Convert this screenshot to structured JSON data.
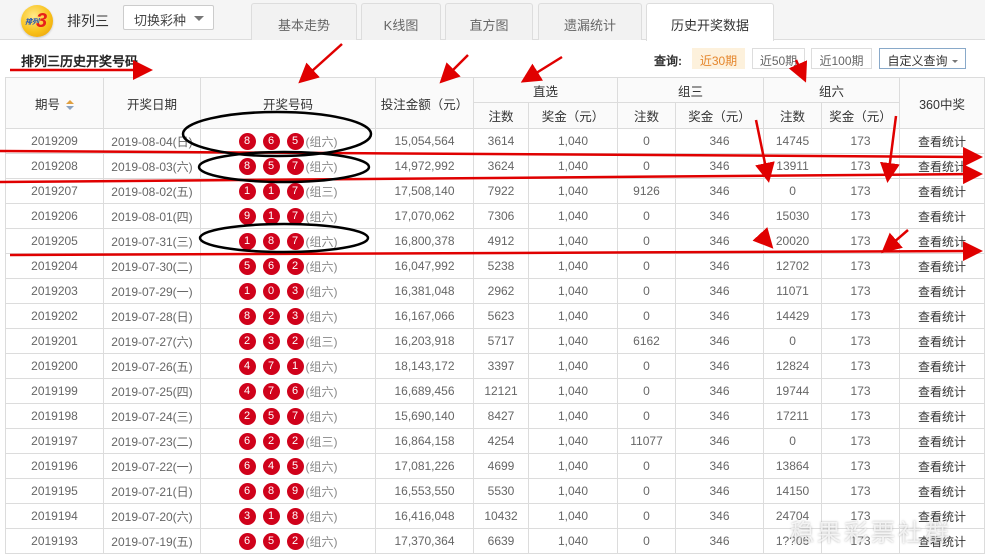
{
  "header": {
    "logo_text": "排列",
    "logo_num": "3",
    "lottery_name": "排列三",
    "switch_label": "切换彩种",
    "tabs": [
      {
        "label": "基本走势",
        "active": false
      },
      {
        "label": "K线图",
        "active": false
      },
      {
        "label": "直方图",
        "active": false
      },
      {
        "label": "遗漏统计",
        "active": false
      },
      {
        "label": "历史开奖数据",
        "active": true
      }
    ]
  },
  "subbar": {
    "title": "排列三历史开奖号码",
    "query_label": "查询:",
    "query_buttons": [
      {
        "label": "近30期",
        "active": true
      },
      {
        "label": "近50期",
        "active": false
      },
      {
        "label": "近100期",
        "active": false
      }
    ],
    "custom_query_label": "自定义查询"
  },
  "table": {
    "headers": {
      "issue": "期号",
      "date": "开奖日期",
      "numbers": "开奖号码",
      "bet_amount": "投注金额（元）",
      "direct": "直选",
      "group3": "组三",
      "group6": "组六",
      "count": "注数",
      "prize": "奖金（元）",
      "prize360": "360中奖"
    },
    "action_label": "查看统计",
    "rows": [
      {
        "issue": "2019209",
        "date": "2019-08-04(日)",
        "balls": [
          "8",
          "6",
          "5"
        ],
        "type": "(组六)",
        "amount": "15,054,564",
        "d_count": "3614",
        "d_prize": "1,040",
        "g3_count": "0",
        "g3_prize": "346",
        "g6_count": "14745",
        "g6_prize": "173"
      },
      {
        "issue": "2019208",
        "date": "2019-08-03(六)",
        "balls": [
          "8",
          "5",
          "7"
        ],
        "type": "(组六)",
        "amount": "14,972,992",
        "d_count": "3624",
        "d_prize": "1,040",
        "g3_count": "0",
        "g3_prize": "346",
        "g6_count": "13911",
        "g6_prize": "173"
      },
      {
        "issue": "2019207",
        "date": "2019-08-02(五)",
        "balls": [
          "1",
          "1",
          "7"
        ],
        "type": "(组三)",
        "amount": "17,508,140",
        "d_count": "7922",
        "d_prize": "1,040",
        "g3_count": "9126",
        "g3_prize": "346",
        "g6_count": "0",
        "g6_prize": "173"
      },
      {
        "issue": "2019206",
        "date": "2019-08-01(四)",
        "balls": [
          "9",
          "1",
          "7"
        ],
        "type": "(组六)",
        "amount": "17,070,062",
        "d_count": "7306",
        "d_prize": "1,040",
        "g3_count": "0",
        "g3_prize": "346",
        "g6_count": "15030",
        "g6_prize": "173"
      },
      {
        "issue": "2019205",
        "date": "2019-07-31(三)",
        "balls": [
          "1",
          "8",
          "7"
        ],
        "type": "(组六)",
        "amount": "16,800,378",
        "d_count": "4912",
        "d_prize": "1,040",
        "g3_count": "0",
        "g3_prize": "346",
        "g6_count": "20020",
        "g6_prize": "173"
      },
      {
        "issue": "2019204",
        "date": "2019-07-30(二)",
        "balls": [
          "5",
          "6",
          "2"
        ],
        "type": "(组六)",
        "amount": "16,047,992",
        "d_count": "5238",
        "d_prize": "1,040",
        "g3_count": "0",
        "g3_prize": "346",
        "g6_count": "12702",
        "g6_prize": "173"
      },
      {
        "issue": "2019203",
        "date": "2019-07-29(一)",
        "balls": [
          "1",
          "0",
          "3"
        ],
        "type": "(组六)",
        "amount": "16,381,048",
        "d_count": "2962",
        "d_prize": "1,040",
        "g3_count": "0",
        "g3_prize": "346",
        "g6_count": "11071",
        "g6_prize": "173"
      },
      {
        "issue": "2019202",
        "date": "2019-07-28(日)",
        "balls": [
          "8",
          "2",
          "3"
        ],
        "type": "(组六)",
        "amount": "16,167,066",
        "d_count": "5623",
        "d_prize": "1,040",
        "g3_count": "0",
        "g3_prize": "346",
        "g6_count": "14429",
        "g6_prize": "173"
      },
      {
        "issue": "2019201",
        "date": "2019-07-27(六)",
        "balls": [
          "2",
          "3",
          "2"
        ],
        "type": "(组三)",
        "amount": "16,203,918",
        "d_count": "5717",
        "d_prize": "1,040",
        "g3_count": "6162",
        "g3_prize": "346",
        "g6_count": "0",
        "g6_prize": "173"
      },
      {
        "issue": "2019200",
        "date": "2019-07-26(五)",
        "balls": [
          "4",
          "7",
          "1"
        ],
        "type": "(组六)",
        "amount": "18,143,172",
        "d_count": "3397",
        "d_prize": "1,040",
        "g3_count": "0",
        "g3_prize": "346",
        "g6_count": "12824",
        "g6_prize": "173"
      },
      {
        "issue": "2019199",
        "date": "2019-07-25(四)",
        "balls": [
          "4",
          "7",
          "6"
        ],
        "type": "(组六)",
        "amount": "16,689,456",
        "d_count": "12121",
        "d_prize": "1,040",
        "g3_count": "0",
        "g3_prize": "346",
        "g6_count": "19744",
        "g6_prize": "173"
      },
      {
        "issue": "2019198",
        "date": "2019-07-24(三)",
        "balls": [
          "2",
          "5",
          "7"
        ],
        "type": "(组六)",
        "amount": "15,690,140",
        "d_count": "8427",
        "d_prize": "1,040",
        "g3_count": "0",
        "g3_prize": "346",
        "g6_count": "17211",
        "g6_prize": "173"
      },
      {
        "issue": "2019197",
        "date": "2019-07-23(二)",
        "balls": [
          "6",
          "2",
          "2"
        ],
        "type": "(组三)",
        "amount": "16,864,158",
        "d_count": "4254",
        "d_prize": "1,040",
        "g3_count": "11077",
        "g3_prize": "346",
        "g6_count": "0",
        "g6_prize": "173"
      },
      {
        "issue": "2019196",
        "date": "2019-07-22(一)",
        "balls": [
          "6",
          "4",
          "5"
        ],
        "type": "(组六)",
        "amount": "17,081,226",
        "d_count": "4699",
        "d_prize": "1,040",
        "g3_count": "0",
        "g3_prize": "346",
        "g6_count": "13864",
        "g6_prize": "173"
      },
      {
        "issue": "2019195",
        "date": "2019-07-21(日)",
        "balls": [
          "6",
          "8",
          "9"
        ],
        "type": "(组六)",
        "amount": "16,553,550",
        "d_count": "5530",
        "d_prize": "1,040",
        "g3_count": "0",
        "g3_prize": "346",
        "g6_count": "14150",
        "g6_prize": "173"
      },
      {
        "issue": "2019194",
        "date": "2019-07-20(六)",
        "balls": [
          "3",
          "1",
          "8"
        ],
        "type": "(组六)",
        "amount": "16,416,048",
        "d_count": "10432",
        "d_prize": "1,040",
        "g3_count": "0",
        "g3_prize": "346",
        "g6_count": "24704",
        "g6_prize": "173"
      },
      {
        "issue": "2019193",
        "date": "2019-07-19(五)",
        "balls": [
          "6",
          "5",
          "2"
        ],
        "type": "(组六)",
        "amount": "17,370,364",
        "d_count": "6639",
        "d_prize": "1,040",
        "g3_count": "0",
        "g3_prize": "346",
        "g6_count": "1??06",
        "g6_prize": "173"
      }
    ]
  },
  "watermark": "稳果彩票社群",
  "colors": {
    "ball": "#d0021b",
    "annotation_red": "#e00000",
    "annotation_black": "#000000",
    "active_query_bg": "#fdf1dc",
    "active_query_text": "#e5862c"
  }
}
